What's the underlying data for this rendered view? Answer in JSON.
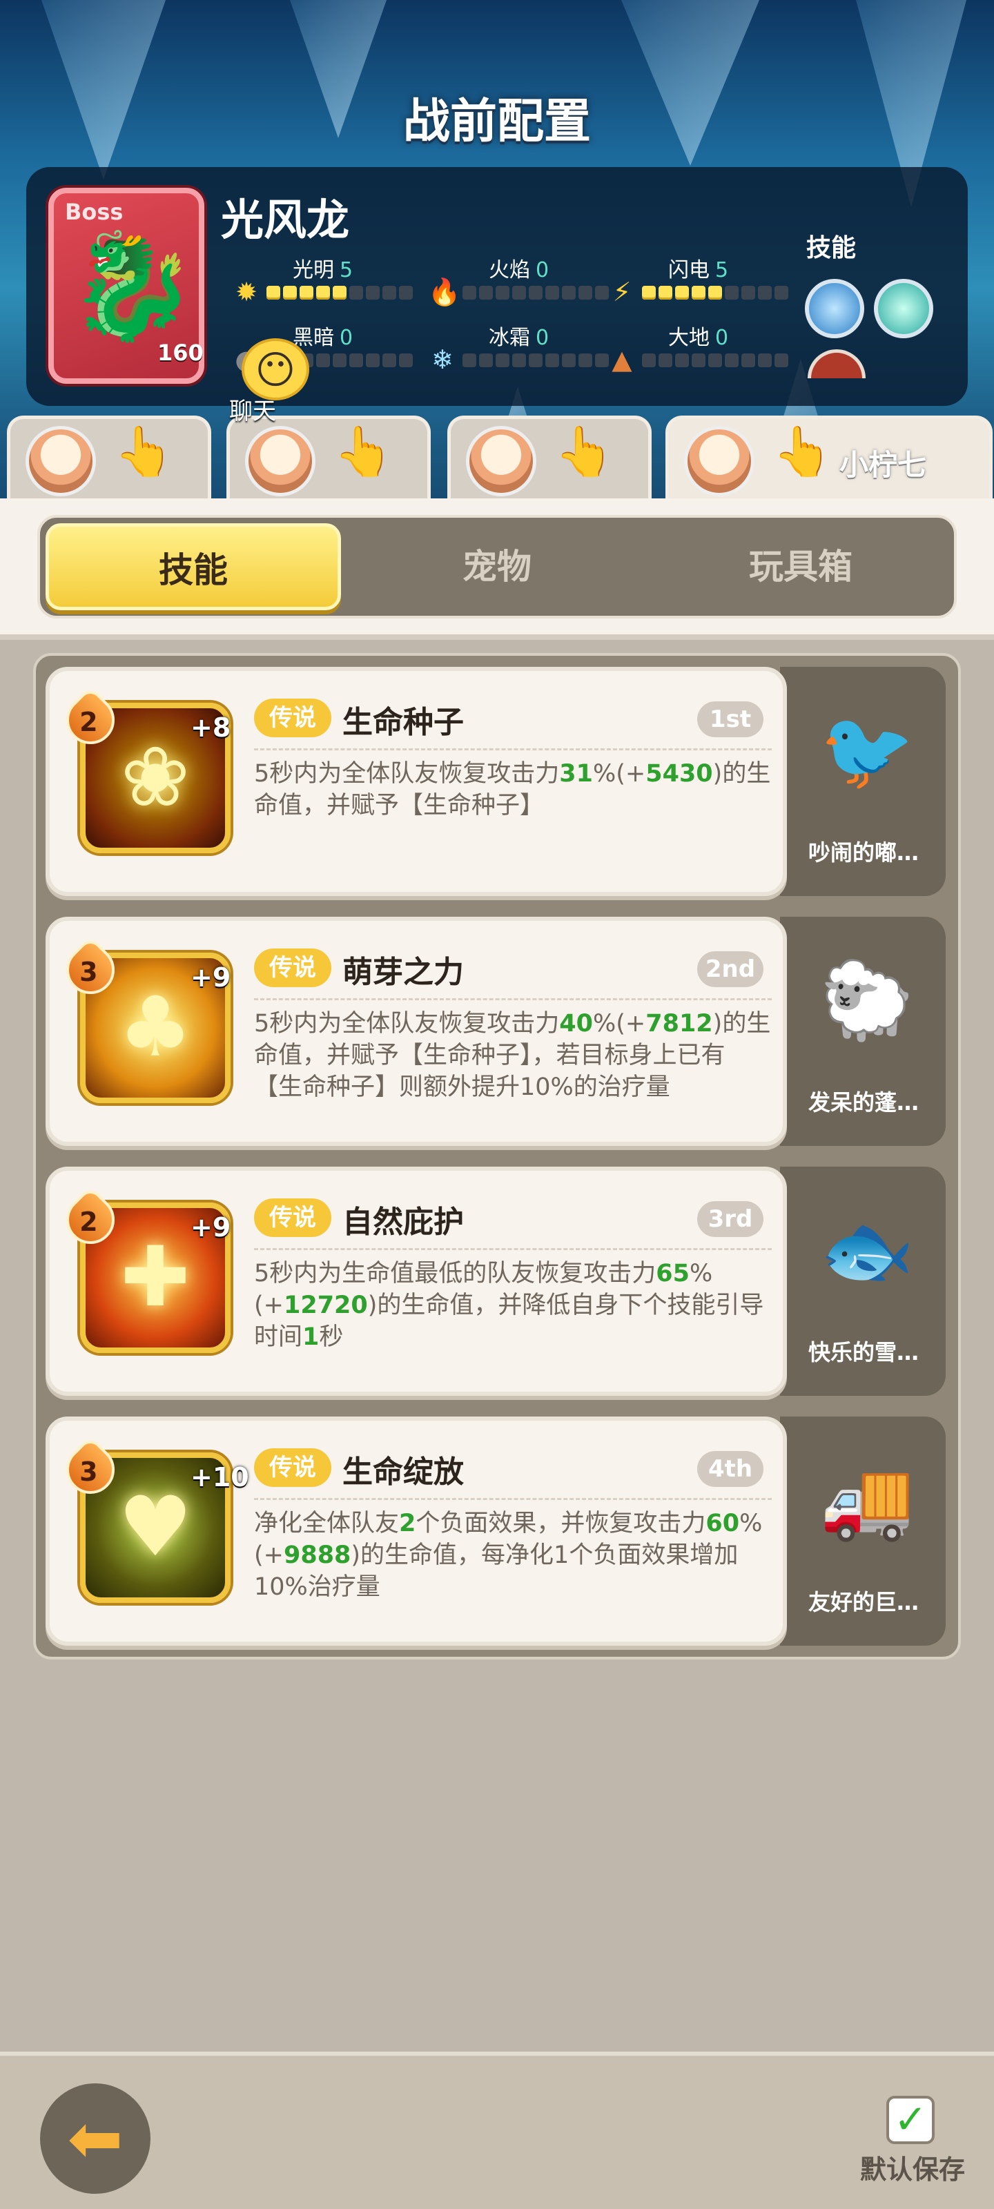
{
  "header": {
    "title": "战前配置"
  },
  "boss": {
    "tag": "Boss",
    "name": "光风龙",
    "level": "160",
    "elements": [
      {
        "name": "光明",
        "value": "5",
        "icon": "sun-icon",
        "filled": 5
      },
      {
        "name": "火焰",
        "value": "0",
        "icon": "flame-icon",
        "filled": 0
      },
      {
        "name": "闪电",
        "value": "5",
        "icon": "lightning-icon",
        "filled": 5
      },
      {
        "name": "黑暗",
        "value": "0",
        "icon": "dark-icon",
        "filled": 0
      },
      {
        "name": "冰霜",
        "value": "0",
        "icon": "snowflake-icon",
        "filled": 0
      },
      {
        "name": "大地",
        "value": "0",
        "icon": "earth-icon",
        "filled": 0
      }
    ],
    "skills_label": "技能"
  },
  "chat": {
    "label": "聊天"
  },
  "character_tabs": {
    "active_name": "小柠七"
  },
  "segment_tabs": [
    "技能",
    "宠物",
    "玩具箱"
  ],
  "skill_cards": [
    {
      "level": "2",
      "plus": "+8",
      "rarity": "传说",
      "name": "生命种子",
      "order": "1st",
      "desc": [
        "5秒内为全体队友恢复攻击力",
        "31",
        "%(+",
        "5430",
        ")的生命值，并赋予【生命种子】"
      ],
      "pet_name": "吵闹的嘟…"
    },
    {
      "level": "3",
      "plus": "+9",
      "rarity": "传说",
      "name": "萌芽之力",
      "order": "2nd",
      "desc": [
        "5秒内为全体队友恢复攻击力",
        "40",
        "%(+",
        "7812",
        ")的生命值，并赋予【生命种子】，若目标身上已有【生命种子】则额外提升10%的治疗量"
      ],
      "pet_name": "发呆的蓬…"
    },
    {
      "level": "2",
      "plus": "+9",
      "rarity": "传说",
      "name": "自然庇护",
      "order": "3rd",
      "desc": [
        "5秒内为生命值最低的队友恢复攻击力",
        "65",
        "%(+",
        "12720",
        ")的生命值，并降低自身下个技能引导时间",
        "1",
        "秒"
      ],
      "pet_name": "快乐的雪…"
    },
    {
      "level": "3",
      "plus": "+10",
      "rarity": "传说",
      "name": "生命绽放",
      "order": "4th",
      "desc": [
        "净化全体队友",
        "2",
        "个负面效果，并恢复攻击力",
        "60",
        "%(+",
        "9888",
        ")的生命值，每净化1个负面效果增加10%治疗量"
      ],
      "pet_name": "友好的巨…"
    }
  ],
  "bottom": {
    "save_label": "默认保存"
  },
  "colors": {
    "accent_yellow": "#f4cc3a",
    "highlight_green": "#2da02d",
    "teal_value": "#5fe0c8"
  }
}
